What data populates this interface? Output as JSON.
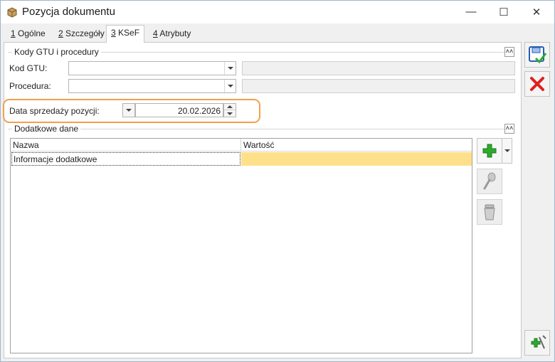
{
  "window": {
    "title": "Pozycja dokumentu",
    "app_icon": "package-icon",
    "controls": {
      "minimize": "—",
      "maximize": "☐",
      "close": "✕"
    }
  },
  "tabs": [
    {
      "hotkey": "1",
      "label": "Ogólne"
    },
    {
      "hotkey": "2",
      "label": "Szczegóły"
    },
    {
      "hotkey": "3",
      "label": "KSeF"
    },
    {
      "hotkey": "4",
      "label": "Atrybuty"
    }
  ],
  "active_tab": "KSeF",
  "gtu_group": {
    "title": "Kody GTU i procedury",
    "kod_gtu_label": "Kod GTU:",
    "kod_gtu_value": "",
    "procedura_label": "Procedura:",
    "procedura_value": ""
  },
  "sale_date": {
    "label": "Data sprzedaży pozycji:",
    "value": "20.02.2026"
  },
  "extra_group": {
    "title": "Dodatkowe dane",
    "columns": [
      "Nazwa",
      "Wartość"
    ],
    "rows": [
      {
        "name": "Informacje dodatkowe",
        "value": ""
      }
    ]
  },
  "side_buttons": [
    "add-icon",
    "edit-icon",
    "delete-icon"
  ],
  "toolbar_buttons": [
    "save-icon",
    "cancel-icon",
    "add-attribute-icon"
  ],
  "colors": {
    "highlight_border": "#f0a050",
    "selected_value_cell": "#ffe08a",
    "accent_green": "#2eaa2e",
    "accent_red": "#e02020"
  }
}
